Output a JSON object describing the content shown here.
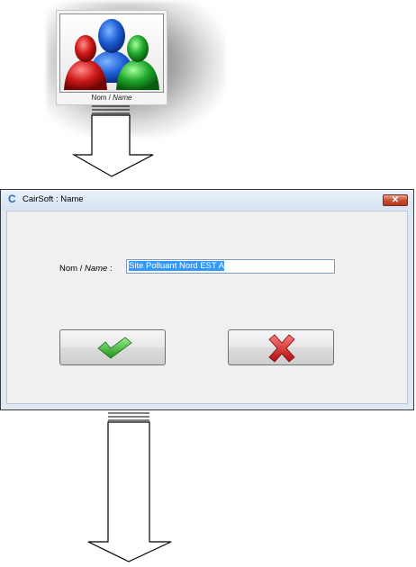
{
  "tile": {
    "caption_nom": "Nom",
    "caption_sep": " / ",
    "caption_name": "Name",
    "icon": "users-group-icon"
  },
  "dialog": {
    "title_logo": "C",
    "title": "CairSoft : Name",
    "close_icon": "close-icon",
    "close_glyph": "✕",
    "label_nom": "Nom",
    "label_sep": " / ",
    "label_name": "Name",
    "label_colon": " :",
    "name_value": "Site Polluant Nord EST A",
    "ok_icon": "checkmark-icon",
    "cancel_icon": "red-cross-icon"
  },
  "colors": {
    "check_green": "#3cb43c",
    "cross_red": "#e02020",
    "selection_blue": "#3399ff",
    "titlebar": "#dfe8f2"
  }
}
